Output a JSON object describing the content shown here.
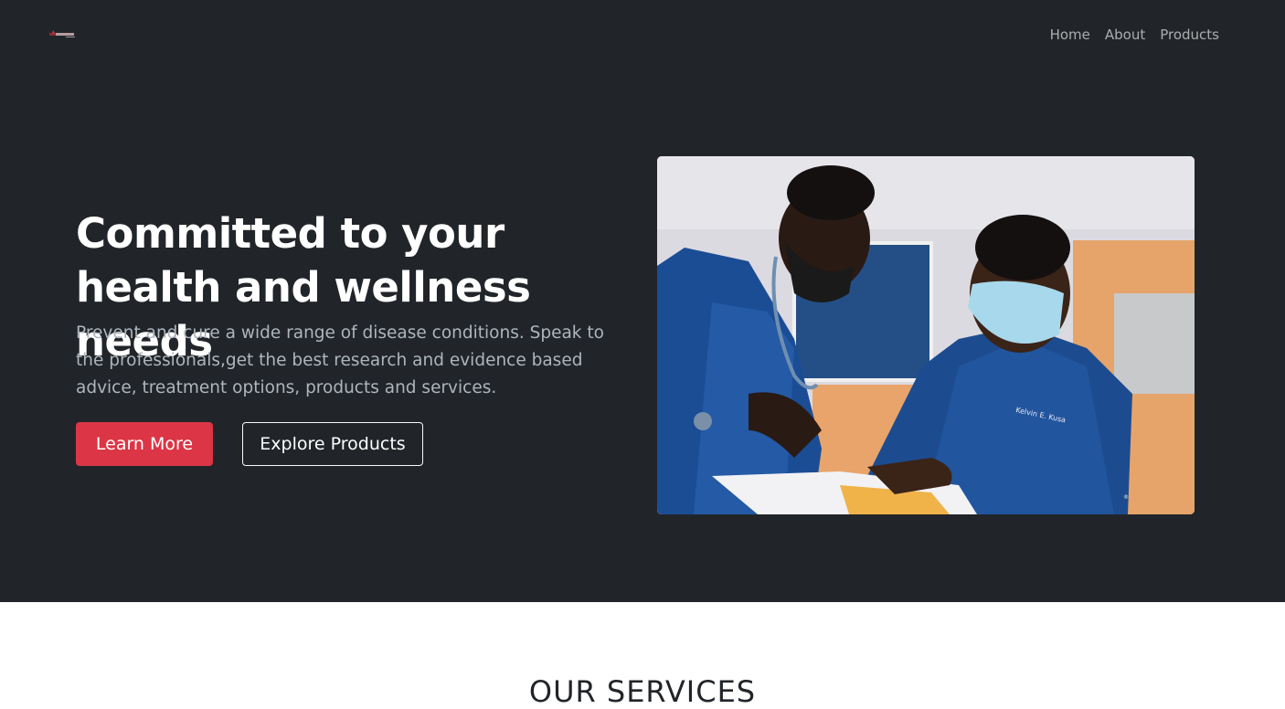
{
  "brand": {
    "logo_icon": "brand-logo-icon",
    "logo_text": "HealthHero"
  },
  "nav": {
    "items": [
      "Home",
      "About",
      "Products"
    ]
  },
  "hero": {
    "headline": "Committed to your health and wellness needs",
    "lead": "Prevent and cure a wide range of disease conditions. Speak to the professionals,get the best research and evidence based advice, treatment options, products and services.",
    "primary_button": "Learn More",
    "secondary_button": "Explore Products"
  },
  "services": {
    "title": "OUR SERVICES"
  },
  "colors": {
    "dark_bg": "#212529",
    "accent": "#dc3545",
    "muted_text": "#adb5bd"
  }
}
